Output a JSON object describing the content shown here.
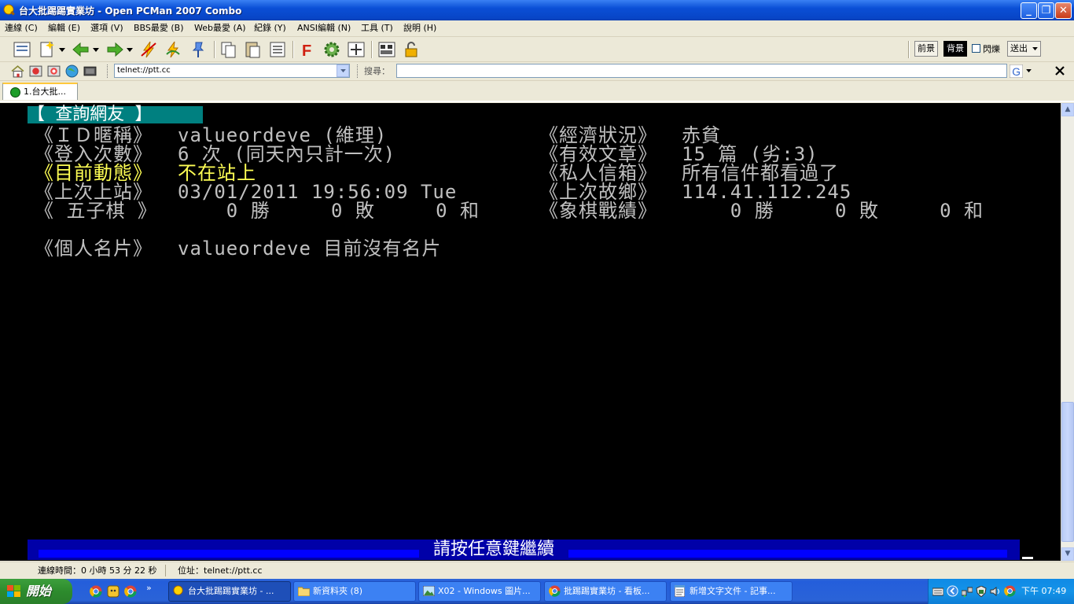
{
  "window": {
    "title": "台大批踢踢實業坊 - Open PCMan 2007 Combo",
    "minimize": "_",
    "maximize": "❐",
    "close": "✕"
  },
  "menu": [
    "連線 (C)",
    "編輯 (E)",
    "選項 (V)",
    "BBS最愛 (B)",
    "Web最愛 (A)",
    "紀錄 (Y)",
    "ANSI編輯 (N)",
    "工具 (T)",
    "說明 (H)"
  ],
  "toolbar": {
    "fg_label": "前景",
    "bg_label": "背景",
    "blink_label": "閃爍",
    "send_label": "送出"
  },
  "address": {
    "value": "telnet://ptt.cc",
    "search_label": "搜尋："
  },
  "tab": {
    "label": "1.台大批..."
  },
  "terminal": {
    "header": "【 查詢網友 】",
    "id_label": "《ＩＤ暱稱》",
    "id_value": "valueordeve (維理)",
    "economy_label": "《經濟狀況》",
    "economy_value": "赤貧",
    "logins_label": "《登入次數》",
    "logins_value": "6 次 (同天內只計一次)",
    "articles_label": "《有效文章》",
    "articles_value": "15 篇 (劣:3)",
    "status_label": "《目前動態》",
    "status_value": "不在站上",
    "mailbox_label": "《私人信箱》",
    "mailbox_value": "所有信件都看過了",
    "lastlogin_label": "《上次上站》",
    "lastlogin_value": "03/01/2011 19:56:09 Tue",
    "lasthome_label": "《上次故鄉》",
    "lasthome_value": "114.41.112.245",
    "gomoku_label": "《 五子棋 》",
    "gomoku_value": "    0 勝     0 敗     0 和",
    "chess_label": "《象棋戰績》",
    "chess_value": "    0 勝     0 敗     0 和",
    "card_label": "《個人名片》",
    "card_value": "valueordeve 目前沒有名片",
    "press_any_key": "請按任意鍵繼續"
  },
  "statusbar": {
    "connect_time": "連線時間：0 小時 53 分 22 秒",
    "address": "位址：telnet://ptt.cc"
  },
  "taskbar": {
    "start": "開始",
    "tasks": [
      "台大批踢踢實業坊 - ...",
      "新資料夾 (8)",
      "X02 - Windows 圖片...",
      "批踢踢實業坊 - 看板...",
      "新增文字文件 - 記事..."
    ],
    "clock": "下午 07:49"
  }
}
